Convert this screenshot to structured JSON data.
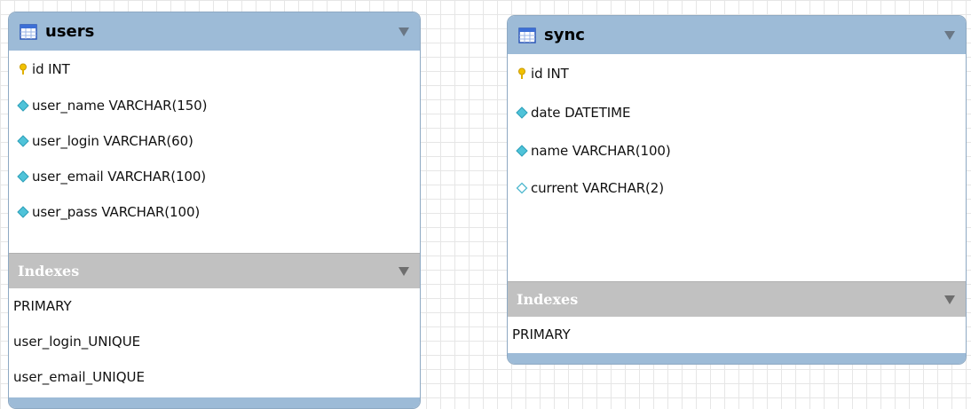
{
  "tables": [
    {
      "name": "users",
      "columns": [
        {
          "text": "id INT",
          "icon": "primary-key-icon"
        },
        {
          "text": "user_name VARCHAR(150)",
          "icon": "column-diamond-icon"
        },
        {
          "text": "user_login VARCHAR(60)",
          "icon": "column-diamond-icon"
        },
        {
          "text": "user_email VARCHAR(100)",
          "icon": "column-diamond-icon"
        },
        {
          "text": "user_pass VARCHAR(100)",
          "icon": "column-diamond-icon"
        }
      ],
      "indexes_label": "Indexes",
      "indexes": [
        "PRIMARY",
        "user_login_UNIQUE",
        "user_email_UNIQUE"
      ]
    },
    {
      "name": "sync",
      "columns": [
        {
          "text": "id INT",
          "icon": "primary-key-icon"
        },
        {
          "text": "date DATETIME",
          "icon": "column-diamond-icon"
        },
        {
          "text": "name VARCHAR(100)",
          "icon": "column-diamond-icon"
        },
        {
          "text": "current VARCHAR(2)",
          "icon": "nullable-diamond-icon"
        }
      ],
      "indexes_label": "Indexes",
      "indexes": [
        "PRIMARY"
      ]
    }
  ],
  "colors": {
    "header": "#9dbbd7",
    "indexes_header": "#c1c1c1",
    "key": "#f2c200",
    "column_diamond": "#4fc3d9"
  }
}
